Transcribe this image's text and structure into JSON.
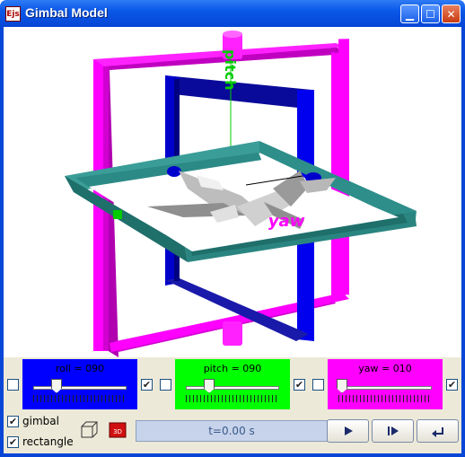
{
  "window": {
    "title": "Gimbal Model",
    "icon_text": "Ejs"
  },
  "scene": {
    "labels": {
      "pitch": "pitch",
      "yaw": "yaw"
    },
    "colors": {
      "outer": "#ff00ff",
      "middle": "#0000cc",
      "inner": "#2c8a86",
      "axis": "#00cc00"
    }
  },
  "controls": {
    "roll": {
      "label": "roll = 090",
      "value": 90,
      "left_checked": false,
      "right_checked": true,
      "color": "#0000ff"
    },
    "pitch": {
      "label": "pitch = 090",
      "value": 90,
      "left_checked": false,
      "right_checked": true,
      "color": "#00ff00"
    },
    "yaw": {
      "label": "yaw = 010",
      "value": 10,
      "left_checked": false,
      "right_checked": true,
      "color": "#ff00ff"
    }
  },
  "options": {
    "gimbal_label": "gimbal",
    "gimbal_checked": true,
    "rectangle_label": "rectangle",
    "rectangle_checked": true
  },
  "time_display": "t=0.00 s",
  "icons": [
    "wireframe-box-icon",
    "3d-view-icon",
    "play-icon",
    "step-icon",
    "reset-icon"
  ]
}
